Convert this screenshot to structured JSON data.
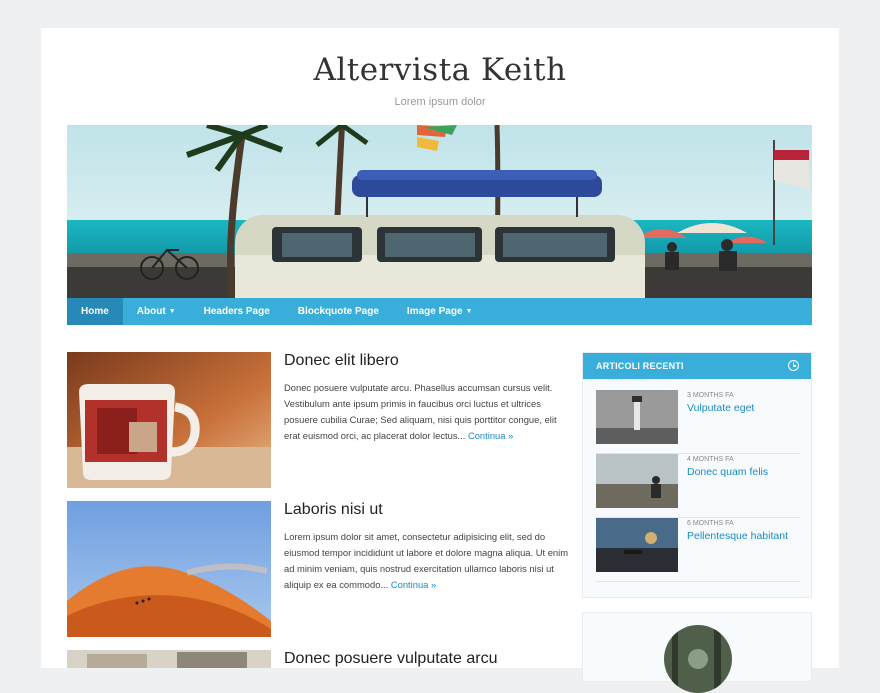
{
  "site": {
    "title": "Altervista Keith",
    "description": "Lorem ipsum dolor"
  },
  "nav": {
    "items": [
      {
        "label": "Home",
        "active": true
      },
      {
        "label": "About",
        "has_submenu": true
      },
      {
        "label": "Headers Page"
      },
      {
        "label": "Blockquote Page"
      },
      {
        "label": "Image Page",
        "has_submenu": true
      }
    ]
  },
  "posts": [
    {
      "title": "Donec elit libero",
      "excerpt": "Donec posuere vulputate arcu. Phasellus accumsan cursus velit. Vestibulum ante ipsum primis in faucibus orci luctus et ultrices posuere cubilia Curae; Sed aliquam, nisi quis porttitor congue, elit erat euismod orci, ac placerat dolor lectus...",
      "more": "Continua »"
    },
    {
      "title": "Laboris nisi ut",
      "excerpt": "Lorem ipsum dolor sit amet, consectetur adipisicing elit, sed do eiusmod tempor incididunt ut labore et dolore magna aliqua. Ut enim ad minim veniam, quis nostrud exercitation ullamco laboris nisi ut aliquip ex ea commodo...",
      "more": "Continua »"
    },
    {
      "title": "Donec posuere vulputate arcu",
      "excerpt": "",
      "more": ""
    }
  ],
  "sidebar": {
    "recent_title": "ARTICOLI RECENTI",
    "recent": [
      {
        "meta": "3 MONTHS FA",
        "title": "Vulputate eget"
      },
      {
        "meta": "4 MONTHS FA",
        "title": "Donec quam felis"
      },
      {
        "meta": "6 MONTHS FA",
        "title": "Pellentesque habitant"
      }
    ]
  },
  "colors": {
    "accent": "#3aaedb",
    "accent_dark": "#2689b8",
    "link": "#1a8bc4"
  }
}
